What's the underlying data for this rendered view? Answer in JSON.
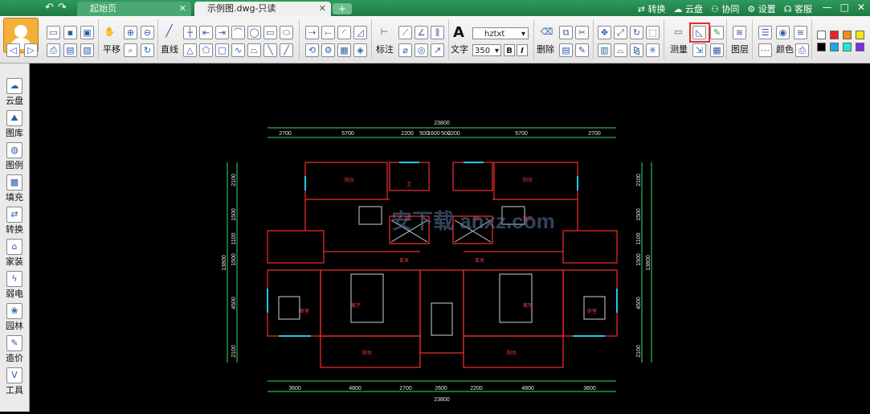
{
  "titlebar": {
    "undo_icon": "undo-arrow-icon",
    "redo_icon": "redo-arrow-icon",
    "tabs": [
      {
        "label": "起始页",
        "active": false
      },
      {
        "label": "示例图.dwg-只读",
        "active": true
      }
    ],
    "add_tab": "+",
    "links": [
      "转换",
      "云盘",
      "协同",
      "设置",
      "客服"
    ],
    "window_controls": [
      "—",
      "□",
      "✕"
    ]
  },
  "ribbon": {
    "labels": {
      "pan": "平移",
      "line": "直线",
      "dimension": "标注",
      "text": "文字",
      "delete": "删除",
      "measure": "测量",
      "layer": "图层",
      "color": "颜色"
    },
    "font_name": "hztxt",
    "font_size": "350",
    "bold": "B",
    "italic": "I",
    "text_glyph": "A",
    "palette": [
      "#ffffff",
      "#e8242a",
      "#f08c1e",
      "#f0e814",
      "#000000",
      "#1ea6e8",
      "#1ee8d2",
      "#7a2ee8"
    ]
  },
  "sidebar": {
    "items": [
      {
        "label": "云盘",
        "icon": "cloud-icon"
      },
      {
        "label": "图库",
        "icon": "gallery-icon"
      },
      {
        "label": "图例",
        "icon": "legend-icon"
      },
      {
        "label": "填充",
        "icon": "hatch-icon"
      },
      {
        "label": "转换",
        "icon": "convert-icon"
      },
      {
        "label": "家装",
        "icon": "home-decor-icon"
      },
      {
        "label": "弱电",
        "icon": "low-voltage-icon"
      },
      {
        "label": "园林",
        "icon": "garden-icon"
      },
      {
        "label": "造价",
        "icon": "cost-icon"
      },
      {
        "label": "工具",
        "icon": "tools-icon"
      }
    ]
  },
  "drawing": {
    "top_total": "23800",
    "top_dims": [
      "2700",
      "5700",
      "2200",
      "500",
      "1600",
      "500",
      "2200",
      "5700",
      "2700"
    ],
    "bottom_dims": [
      "3600",
      "4800",
      "2700",
      "2600",
      "2200",
      "4800",
      "3600"
    ],
    "bottom_total": "23800",
    "left_dims": [
      "2100",
      "1500",
      "1100",
      "1500",
      "4500",
      "2100"
    ],
    "left_total": "13800",
    "right_dims": [
      "2100",
      "1500",
      "1100",
      "1500",
      "4500",
      "2100"
    ],
    "right_total": "13800",
    "room_labels": [
      "阳台",
      "卫",
      "厨",
      "阳台",
      "厨",
      "餐厅",
      "玄关",
      "玄关",
      "卧室",
      "客厅",
      "客厅",
      "卧室",
      "阳台",
      "阳台"
    ],
    "watermark": "安下载 anxz.com"
  }
}
